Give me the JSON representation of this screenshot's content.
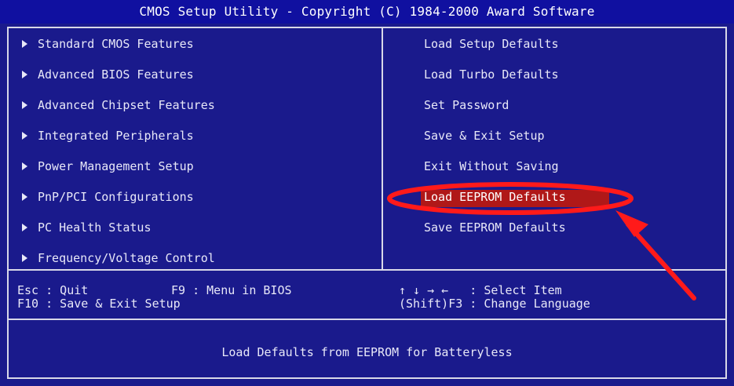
{
  "title": "CMOS Setup Utility - Copyright (C) 1984-2000 Award Software",
  "left_menu": [
    {
      "label": "Standard CMOS Features"
    },
    {
      "label": "Advanced BIOS Features"
    },
    {
      "label": "Advanced Chipset Features"
    },
    {
      "label": "Integrated Peripherals"
    },
    {
      "label": "Power Management Setup"
    },
    {
      "label": "PnP/PCI Configurations"
    },
    {
      "label": "PC Health Status"
    },
    {
      "label": "Frequency/Voltage Control"
    }
  ],
  "right_menu": [
    {
      "label": "Load Setup Defaults"
    },
    {
      "label": "Load Turbo Defaults"
    },
    {
      "label": "Set Password"
    },
    {
      "label": "Save & Exit Setup"
    },
    {
      "label": "Exit Without Saving"
    },
    {
      "label": "Load EEPROM Defaults",
      "selected": true
    },
    {
      "label": "Save EEPROM Defaults"
    }
  ],
  "help_keys": {
    "esc": "Esc : Quit",
    "f9": "F9 : Menu in BIOS",
    "f10": "F10 : Save & Exit Setup",
    "arrows": "↑ ↓ → ←   : Select Item",
    "shift_f3": "(Shift)F3 : Change Language"
  },
  "status_text": "Load Defaults from EEPROM for Batteryless",
  "colors": {
    "background": "#1a1a8c",
    "title_bar": "#1010a0",
    "highlight": "#b01818",
    "annotation": "#ff1a1a"
  }
}
